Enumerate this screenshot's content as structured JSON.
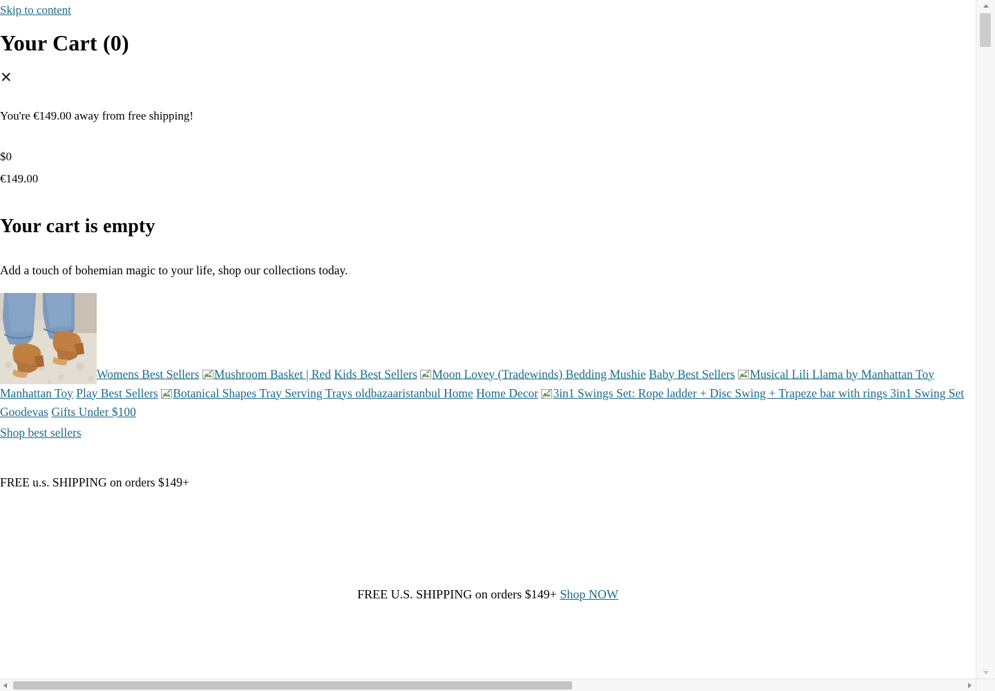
{
  "page": {
    "skip_link": "Skip to content",
    "cart_title": "Your Cart (0)",
    "close_icon": "close-icon",
    "close_glyph": "✕",
    "free_shipping_message": "You're €149.00 away from free shipping!",
    "progress_min_label": "$0",
    "progress_max_label": "€149.00",
    "empty_title": "Your cart is empty",
    "empty_subtitle": "Add a touch of bohemian magic to your life, shop our collections today.",
    "shop_best_sellers_link": "Shop best sellers",
    "free_shipping_note": "FREE u.s. SHIPPING on orders $149+",
    "link_color": "#1a6b8a",
    "text_color": "#000000",
    "background_color": "#ffffff"
  },
  "products": [
    {
      "image_kind": "photo-thumb",
      "image_alt": "Womens sandals on rug",
      "link_text": "Womens Best Sellers"
    },
    {
      "image_kind": "broken-image",
      "image_alt": "Mushroom Basket | Red",
      "link_text": "Kids Best Sellers"
    },
    {
      "image_kind": "broken-image",
      "image_alt": "Moon Lovey (Tradewinds) Bedding Mushie",
      "link_text": "Baby Best Sellers"
    },
    {
      "image_kind": "broken-image",
      "image_alt": "Musical Lili Llama by Manhattan Toy Manhattan Toy",
      "link_text": "Play Best Sellers"
    },
    {
      "image_kind": "broken-image",
      "image_alt": "Botanical Shapes Tray Serving Trays oldbazaaristanbul Home",
      "link_text": "Home Decor"
    },
    {
      "image_kind": "broken-image",
      "image_alt": "3in1 Swings Set: Rope ladder + Disc Swing + Trapeze bar with rings 3in1 Swing Set Goodevas",
      "link_text": "Gifts Under $100"
    }
  ],
  "bottom_banner": {
    "text": "FREE U.S. SHIPPING on orders $149+",
    "link_text": "Shop NOW"
  },
  "scrollbars": {
    "vertical_position": "near-top",
    "horizontal_position": "left"
  }
}
